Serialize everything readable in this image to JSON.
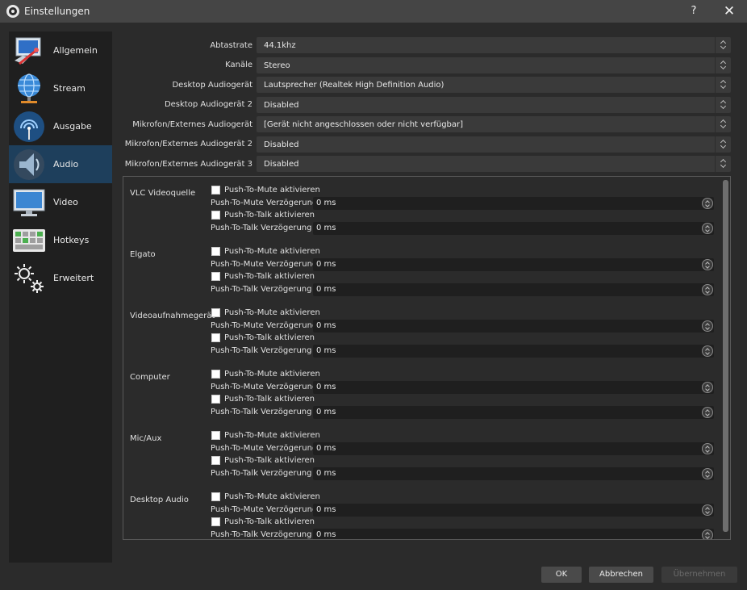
{
  "window": {
    "title": "Einstellungen",
    "help": "?",
    "close": "✕"
  },
  "sidebar": {
    "items": [
      {
        "label": "Allgemein",
        "icon": "general-icon"
      },
      {
        "label": "Stream",
        "icon": "stream-icon"
      },
      {
        "label": "Ausgabe",
        "icon": "output-icon"
      },
      {
        "label": "Audio",
        "icon": "audio-icon",
        "active": true
      },
      {
        "label": "Video",
        "icon": "video-icon"
      },
      {
        "label": "Hotkeys",
        "icon": "hotkeys-icon"
      },
      {
        "label": "Erweitert",
        "icon": "advanced-icon"
      }
    ]
  },
  "settings": [
    {
      "label": "Abtastrate",
      "value": "44.1khz"
    },
    {
      "label": "Kanäle",
      "value": "Stereo"
    },
    {
      "label": "Desktop Audiogerät",
      "value": "Lautsprecher (Realtek High Definition Audio)"
    },
    {
      "label": "Desktop Audiogerät 2",
      "value": "Disabled"
    },
    {
      "label": "Mikrofon/Externes Audiogerät",
      "value": "[Gerät nicht angeschlossen oder nicht verfügbar]"
    },
    {
      "label": "Mikrofon/Externes Audiogerät 2",
      "value": "Disabled"
    },
    {
      "label": "Mikrofon/Externes Audiogerät 3",
      "value": "Disabled"
    }
  ],
  "hotkeys": {
    "mute_label": "Push-To-Mute aktivieren",
    "mute_delay_label": "Push-To-Mute Verzögerung",
    "talk_label": "Push-To-Talk aktivieren",
    "talk_delay_label": "Push-To-Talk Verzögerung",
    "sources": [
      {
        "name": "VLC Videoquelle",
        "mute_delay": "0 ms",
        "talk_delay": "0 ms"
      },
      {
        "name": "Elgato",
        "mute_delay": "0 ms",
        "talk_delay": "0 ms"
      },
      {
        "name": "Videoaufnahmegerät",
        "mute_delay": "0 ms",
        "talk_delay": "0 ms"
      },
      {
        "name": "Computer",
        "mute_delay": "0 ms",
        "talk_delay": "0 ms"
      },
      {
        "name": "Mic/Aux",
        "mute_delay": "0 ms",
        "talk_delay": "0 ms"
      },
      {
        "name": "Desktop Audio",
        "mute_delay": "0 ms",
        "talk_delay": "0 ms"
      }
    ]
  },
  "buttons": {
    "ok": "OK",
    "cancel": "Abbrechen",
    "apply": "Übernehmen"
  },
  "colors": {
    "background": "#2b2b2b",
    "sidebar": "#1f1f1f",
    "active": "#1e3f5c",
    "control": "#3a3a3a"
  }
}
